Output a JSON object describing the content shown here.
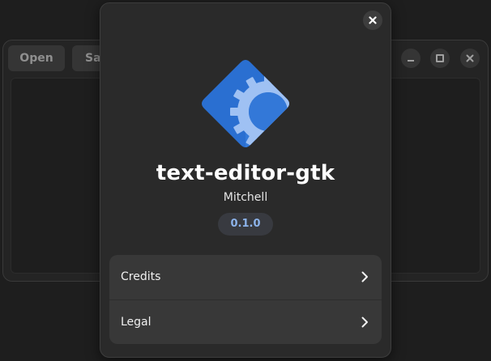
{
  "background_window": {
    "open_label": "Open",
    "save_label_partial": "Sa"
  },
  "about_dialog": {
    "app_name": "text-editor-gtk",
    "developer": "Mitchell",
    "version": "0.1.0",
    "rows": [
      {
        "label": "Credits",
        "icon": "chevron-right-icon"
      },
      {
        "label": "Legal",
        "icon": "chevron-right-icon"
      }
    ],
    "icons": {
      "close": "close-icon",
      "app": "app-icon"
    }
  },
  "colors": {
    "accent": "#8cb3ea",
    "icon_blue_dark": "#2a6fd1",
    "icon_blue_light": "#9fc1f3",
    "dialog_bg": "#2a2a2a",
    "list_bg": "#383838"
  }
}
